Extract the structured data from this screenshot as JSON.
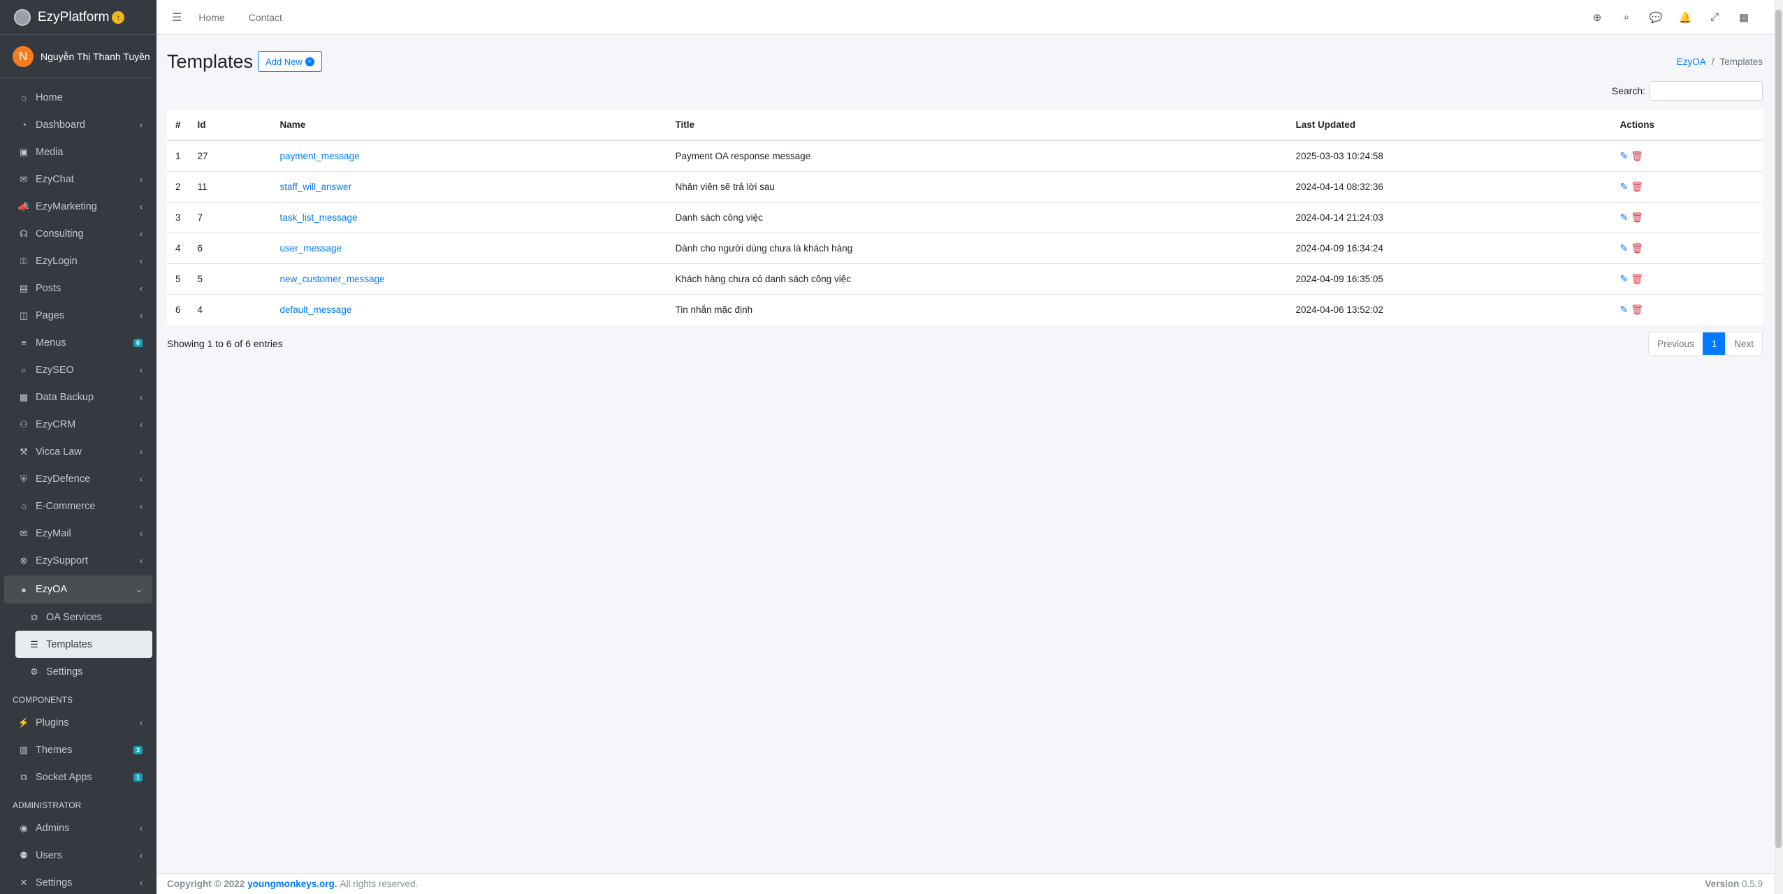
{
  "brand": {
    "name": "EzyPlatform",
    "logo_icon": "gear-logo-icon",
    "update_icon": "arrow-up-circle-icon"
  },
  "user": {
    "initial": "N",
    "name": "Nguyễn Thị Thanh Tuyền"
  },
  "sidebar": {
    "items": [
      {
        "label": "Home",
        "icon": "home-icon"
      },
      {
        "label": "Dashboard",
        "icon": "dashboard-icon"
      },
      {
        "label": "Media",
        "icon": "image-icon"
      },
      {
        "label": "EzyChat",
        "icon": "chat-icon"
      },
      {
        "label": "EzyMarketing",
        "icon": "bullhorn-icon"
      },
      {
        "label": "Consulting",
        "icon": "headset-icon"
      },
      {
        "label": "EzyLogin",
        "icon": "user-lock-icon"
      },
      {
        "label": "Posts",
        "icon": "book-icon"
      },
      {
        "label": "Pages",
        "icon": "columns-icon"
      },
      {
        "label": "Menus",
        "icon": "bars-icon",
        "badge": "0"
      },
      {
        "label": "EzySEO",
        "icon": "magnify-icon"
      },
      {
        "label": "Data Backup",
        "icon": "box-icon"
      },
      {
        "label": "EzyCRM",
        "icon": "handshake-icon"
      },
      {
        "label": "Vicca Law",
        "icon": "gavel-icon"
      },
      {
        "label": "EzyDefence",
        "icon": "shield-icon"
      },
      {
        "label": "E-Commerce",
        "icon": "store-icon"
      },
      {
        "label": "EzyMail",
        "icon": "envelope-icon"
      },
      {
        "label": "EzySupport",
        "icon": "lifering-icon"
      }
    ],
    "open_item": {
      "label": "EzyOA",
      "icon": "circle-icon"
    },
    "sub_items": [
      {
        "label": "OA Services",
        "icon": "cubes-icon"
      },
      {
        "label": "Templates",
        "icon": "list-icon"
      },
      {
        "label": "Settings",
        "icon": "cogs-icon"
      }
    ],
    "components_header": "COMPONENTS",
    "components": [
      {
        "label": "Plugins",
        "icon": "plug-icon"
      },
      {
        "label": "Themes",
        "icon": "palette-icon",
        "badge": "3"
      },
      {
        "label": "Socket Apps",
        "icon": "cubes-icon",
        "badge": "1"
      }
    ],
    "admin_header": "ADMINISTRATOR",
    "admin": [
      {
        "label": "Admins",
        "icon": "user-circle-icon"
      },
      {
        "label": "Users",
        "icon": "users-icon"
      },
      {
        "label": "Settings",
        "icon": "tools-icon"
      }
    ]
  },
  "topbar": {
    "home": "Home",
    "contact": "Contact",
    "icons": [
      "globe-icon",
      "search-icon",
      "comments-icon",
      "bell-icon",
      "expand-icon",
      "apps-grid-icon"
    ]
  },
  "page": {
    "title": "Templates",
    "add_new": "Add New",
    "search_label": "Search:"
  },
  "breadcrumb": {
    "parent": "EzyOA",
    "current": "Templates"
  },
  "table": {
    "headers": [
      "#",
      "Id",
      "Name",
      "Title",
      "Last Updated",
      "Actions"
    ],
    "rows": [
      {
        "n": "1",
        "id": "27",
        "name": "payment_message",
        "title": "Payment OA response message",
        "updated": "2025-03-03 10:24:58"
      },
      {
        "n": "2",
        "id": "11",
        "name": "staff_will_answer",
        "title": "Nhân viên sẽ trả lời sau",
        "updated": "2024-04-14 08:32:36"
      },
      {
        "n": "3",
        "id": "7",
        "name": "task_list_message",
        "title": "Danh sách công việc",
        "updated": "2024-04-14 21:24:03"
      },
      {
        "n": "4",
        "id": "6",
        "name": "user_message",
        "title": "Dành cho người dùng chưa là khách hàng",
        "updated": "2024-04-09 16:34:24"
      },
      {
        "n": "5",
        "id": "5",
        "name": "new_customer_message",
        "title": "Khách hàng chưa có danh sách công việc",
        "updated": "2024-04-09 16:35:05"
      },
      {
        "n": "6",
        "id": "4",
        "name": "default_message",
        "title": "Tin nhắn mặc định",
        "updated": "2024-04-06 13:52:02"
      }
    ]
  },
  "pagination": {
    "info": "Showing 1 to 6 of 6 entries",
    "previous": "Previous",
    "current": "1",
    "next": "Next"
  },
  "footer": {
    "copyright": "Copyright © 2022",
    "link": "youngmonkeys.org.",
    "rights": "All rights reserved.",
    "version_label": "Version",
    "version": "0.5.9"
  }
}
